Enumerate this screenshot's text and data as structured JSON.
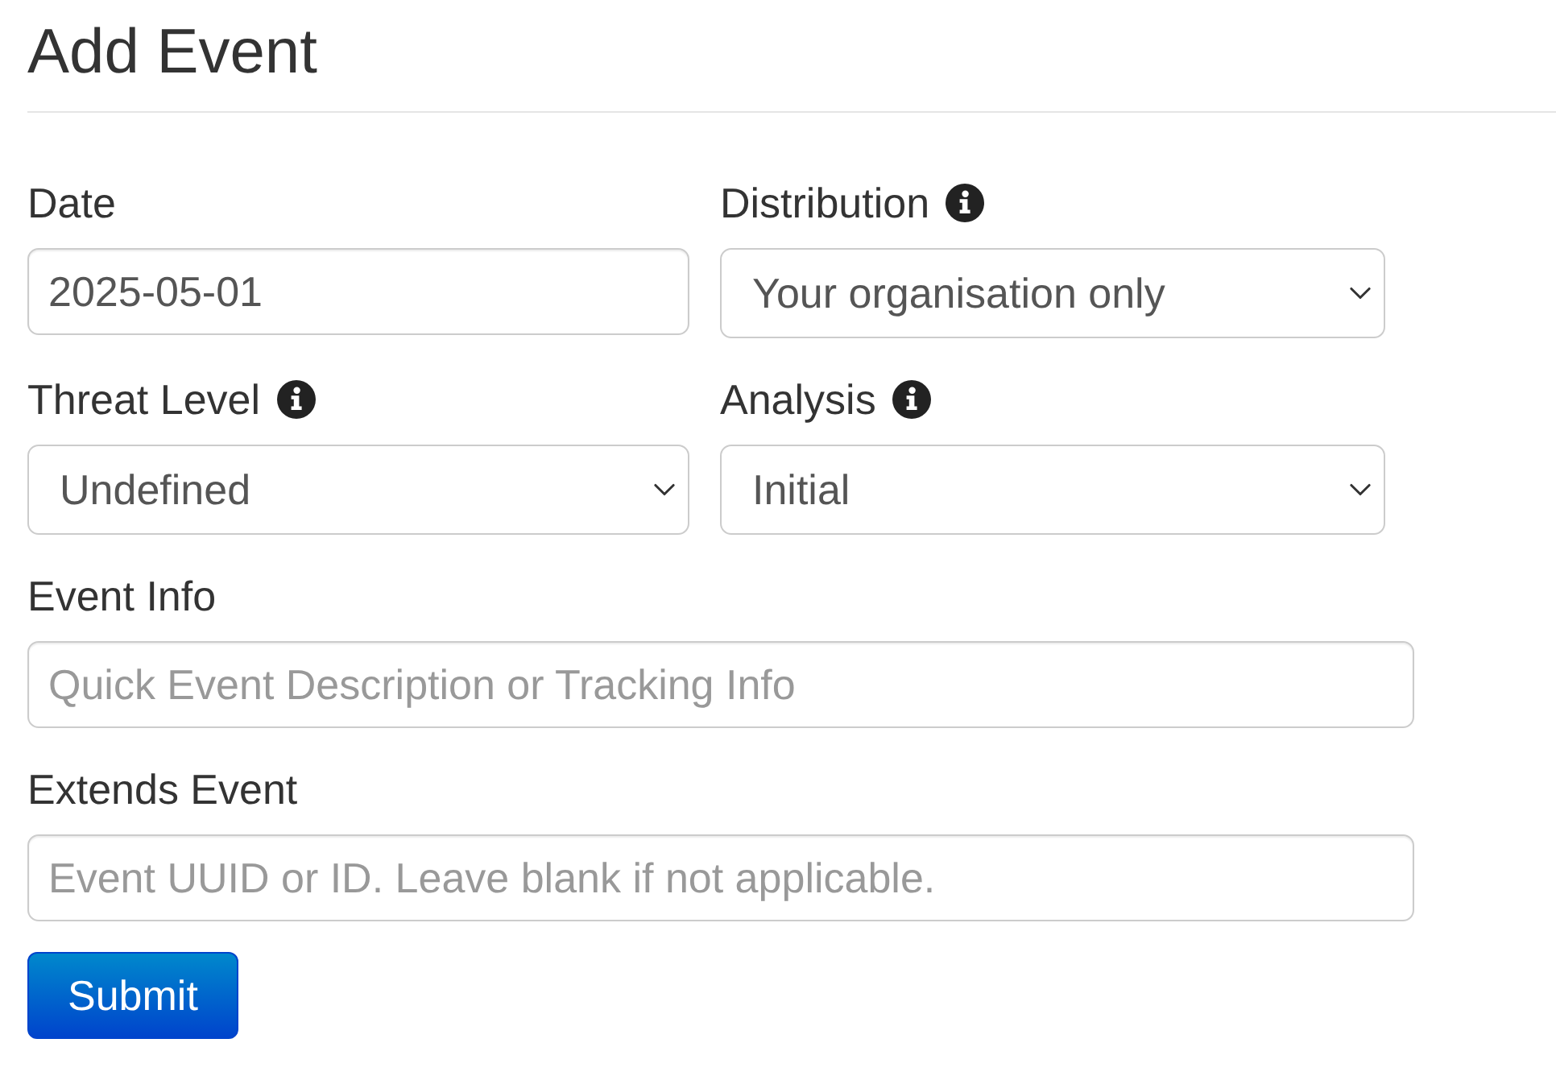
{
  "page": {
    "title": "Add Event"
  },
  "rows": [
    [
      {
        "kind": "input",
        "label": "Date",
        "info": false,
        "value": "2025-05-01"
      },
      {
        "kind": "select",
        "label": "Distribution",
        "info": true,
        "value": "Your organisation only"
      }
    ],
    [
      {
        "kind": "select",
        "label": "Threat Level",
        "info": true,
        "value": "Undefined"
      },
      {
        "kind": "select",
        "label": "Analysis",
        "info": true,
        "value": "Initial"
      }
    ],
    [
      {
        "kind": "input",
        "label": "Event Info",
        "info": false,
        "placeholder": "Quick Event Description or Tracking Info"
      }
    ],
    [
      {
        "kind": "input",
        "label": "Extends Event",
        "info": false,
        "placeholder": "Event UUID or ID. Leave blank if not applicable."
      }
    ]
  ],
  "submit": {
    "label": "Submit"
  }
}
